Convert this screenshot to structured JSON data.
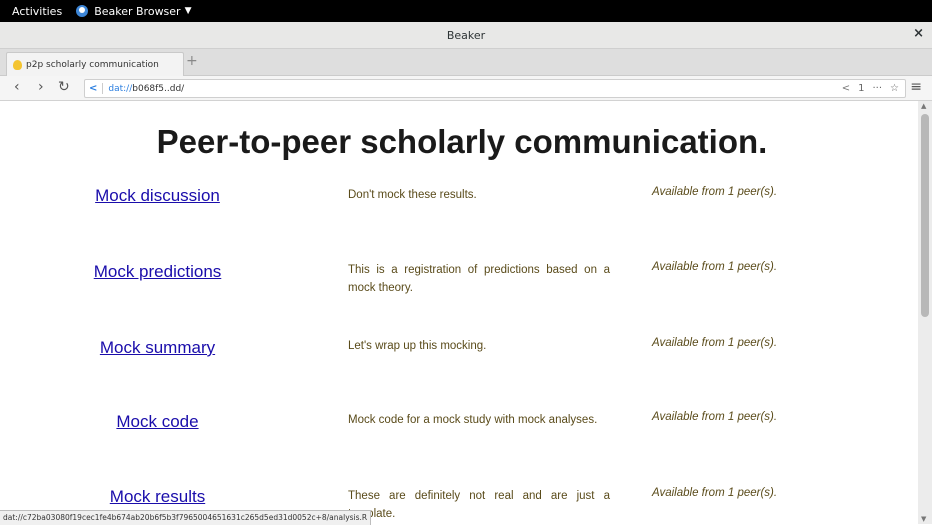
{
  "system_bar": {
    "activities": "Activities",
    "app_name": "Beaker Browser"
  },
  "window": {
    "title": "Beaker"
  },
  "tab": {
    "title": "p2p scholarly communication",
    "new_tab_symbol": "+"
  },
  "address_bar": {
    "scheme": "dat://",
    "host": "b068f5..dd/",
    "peer_count": "1"
  },
  "page": {
    "title": "Peer-to-peer scholarly communication.",
    "items": [
      {
        "title": "Mock discussion",
        "description": "Don't mock these results.",
        "availability": "Available from 1 peer(s)."
      },
      {
        "title": "Mock predictions",
        "description": "This is a registration of predictions based on a mock theory.",
        "availability": "Available from 1 peer(s)."
      },
      {
        "title": "Mock summary",
        "description": "Let's wrap up this mocking.",
        "availability": "Available from 1 peer(s)."
      },
      {
        "title": "Mock code",
        "description": "Mock code for a mock study with mock analyses.",
        "availability": "Available from 1 peer(s)."
      },
      {
        "title": "Mock results",
        "description": "These are definitely not real and are just a template.",
        "availability": "Available from 1 peer(s)."
      }
    ]
  },
  "status_bar": {
    "url": "dat://c72ba03080f19cec1fe4b674ab20b6f5b3f7965004651631c265d5ed31d0052c+8/analysis.R"
  }
}
